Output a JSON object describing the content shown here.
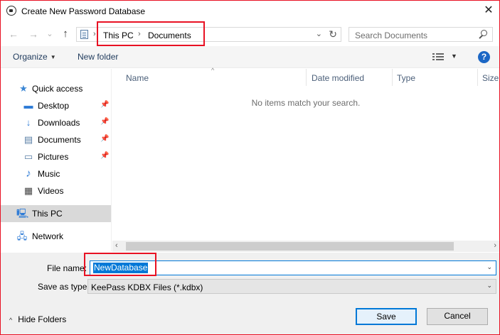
{
  "window": {
    "title": "Create New Password Database",
    "close_symbol": "✕"
  },
  "nav": {
    "back_symbol": "←",
    "forward_symbol": "→",
    "recent_symbol": "⌄",
    "up_symbol": "↑",
    "breadcrumb": [
      "This PC",
      "Documents"
    ],
    "breadcrumb_sep": "›",
    "dropdown_symbol": "⌄",
    "refresh_symbol": "↻",
    "search_placeholder": "Search Documents"
  },
  "toolbar": {
    "organize_label": "Organize",
    "organize_caret": "▼",
    "new_folder_label": "New folder",
    "view_caret": "▼",
    "help_label": "?"
  },
  "sidebar": {
    "pin_symbol": "📌",
    "items": [
      {
        "label": "Quick access",
        "icon": "star-icon",
        "glyph": "★",
        "color": "#3a86d4"
      },
      {
        "label": "Desktop",
        "icon": "desktop-icon",
        "glyph": "▬",
        "color": "#2e7bd6",
        "pinned": true
      },
      {
        "label": "Downloads",
        "icon": "download-arrow-icon",
        "glyph": "↓",
        "color": "#2e7bd6",
        "pinned": true
      },
      {
        "label": "Documents",
        "icon": "document-icon",
        "glyph": "▤",
        "color": "#5a7fa6",
        "pinned": true
      },
      {
        "label": "Pictures",
        "icon": "picture-icon",
        "glyph": "▭",
        "color": "#5a7fa6",
        "pinned": true
      },
      {
        "label": "Music",
        "icon": "music-note-icon",
        "glyph": "♪",
        "color": "#2e7bd6"
      },
      {
        "label": "Videos",
        "icon": "film-icon",
        "glyph": "▦",
        "color": "#444444"
      },
      {
        "label": "This PC",
        "icon": "computer-icon",
        "glyph": "🖳",
        "color": "#2e7bd6",
        "selected": true
      },
      {
        "label": "Network",
        "icon": "network-icon",
        "glyph": "🖧",
        "color": "#2e7bd6"
      }
    ]
  },
  "files": {
    "columns": [
      "Name",
      "Date modified",
      "Type",
      "Size"
    ],
    "sort_symbol": "^",
    "empty_message": "No items match your search."
  },
  "scrollbar": {
    "left_symbol": "‹",
    "right_symbol": "›"
  },
  "form": {
    "file_name_label": "File name:",
    "file_name_value": "NewDatabase",
    "save_type_label": "Save as type:",
    "save_type_value": "KeePass KDBX Files (*.kdbx)",
    "dropdown_symbol": "⌄"
  },
  "footer": {
    "hide_folders_label": "Hide Folders",
    "hide_caret": "^",
    "save_label": "Save",
    "cancel_label": "Cancel"
  },
  "colors": {
    "annotation": "#e81123",
    "accent": "#0078d7",
    "help": "#1c67c5"
  }
}
